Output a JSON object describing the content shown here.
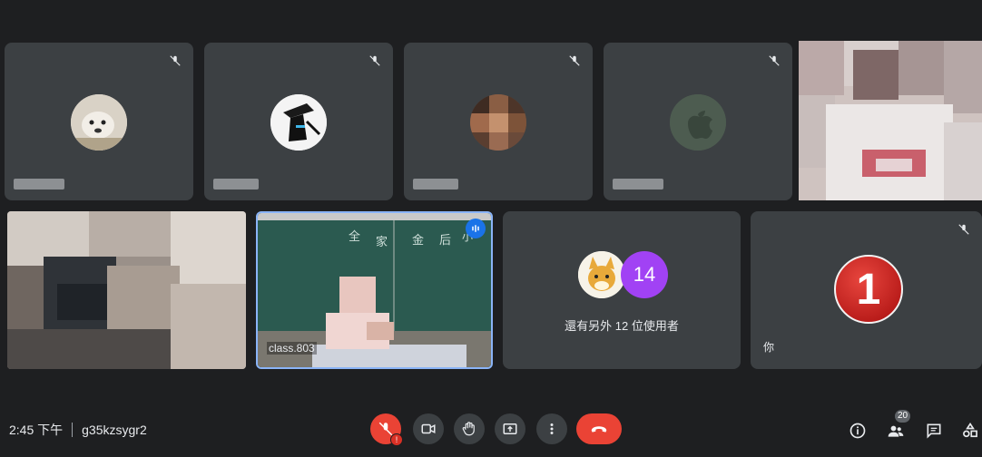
{
  "meeting": {
    "time": "2:45 下午",
    "code": "g35kzsygr2"
  },
  "tiles": {
    "teacher_label": "class.803",
    "others": {
      "count_badge": "14",
      "text": "還有另外 12 位使用者"
    },
    "self": {
      "label": "你",
      "avatar_digit": "1"
    }
  },
  "controls": {
    "participants_count": "20"
  },
  "colors": {
    "background": "#1e1f21",
    "tile": "#3c4043",
    "hangup": "#ea4335",
    "purple_badge": "#a142f4",
    "speaking_border": "#8ab4f8"
  }
}
